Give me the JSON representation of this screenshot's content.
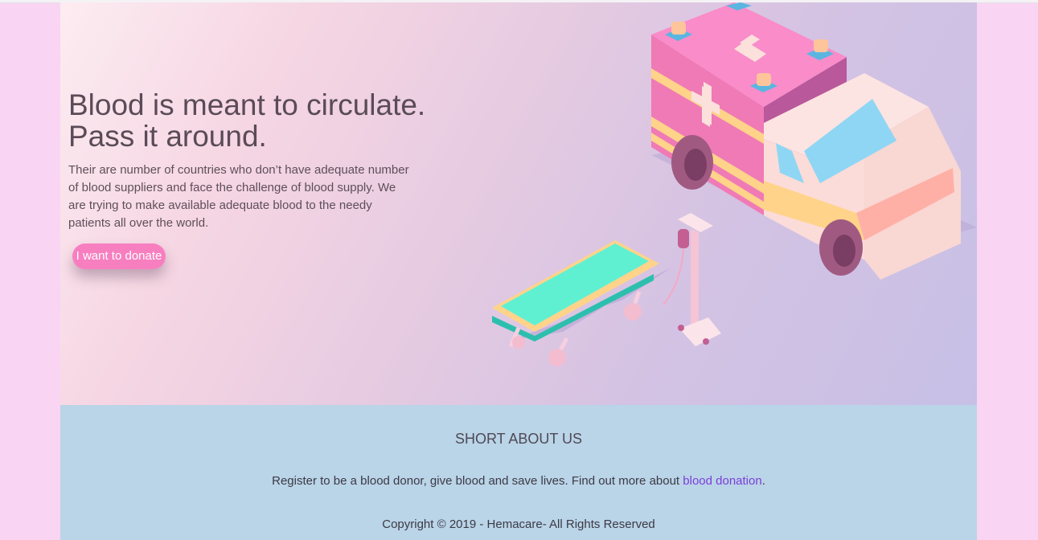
{
  "hero": {
    "headline_line1": "Blood is meant to circulate.",
    "headline_line2": "Pass it around.",
    "description": "Their are number of countries who don’t have adequate number of blood suppliers and face the challenge of blood supply. We are trying to make available adequate blood to the needy patients all over the world.",
    "donate_button_label": "I want to donate"
  },
  "about": {
    "title": "SHORT ABOUT US",
    "text_before_link": "Register to be a blood donor, give blood and save lives. Find out more about ",
    "link_text": "blood donation",
    "text_after_link": "."
  },
  "footer": {
    "copyright": "Copyright © 2019 - Hemacare- All Rights Reserved"
  },
  "colors": {
    "page_background": "#f9d5f3",
    "button": "#f77fc0",
    "footer_background": "#bad4e8",
    "link": "#7a3fd8"
  },
  "illustration": {
    "icons": [
      "ambulance-icon",
      "stretcher-icon",
      "iv-drip-stand-icon"
    ]
  }
}
